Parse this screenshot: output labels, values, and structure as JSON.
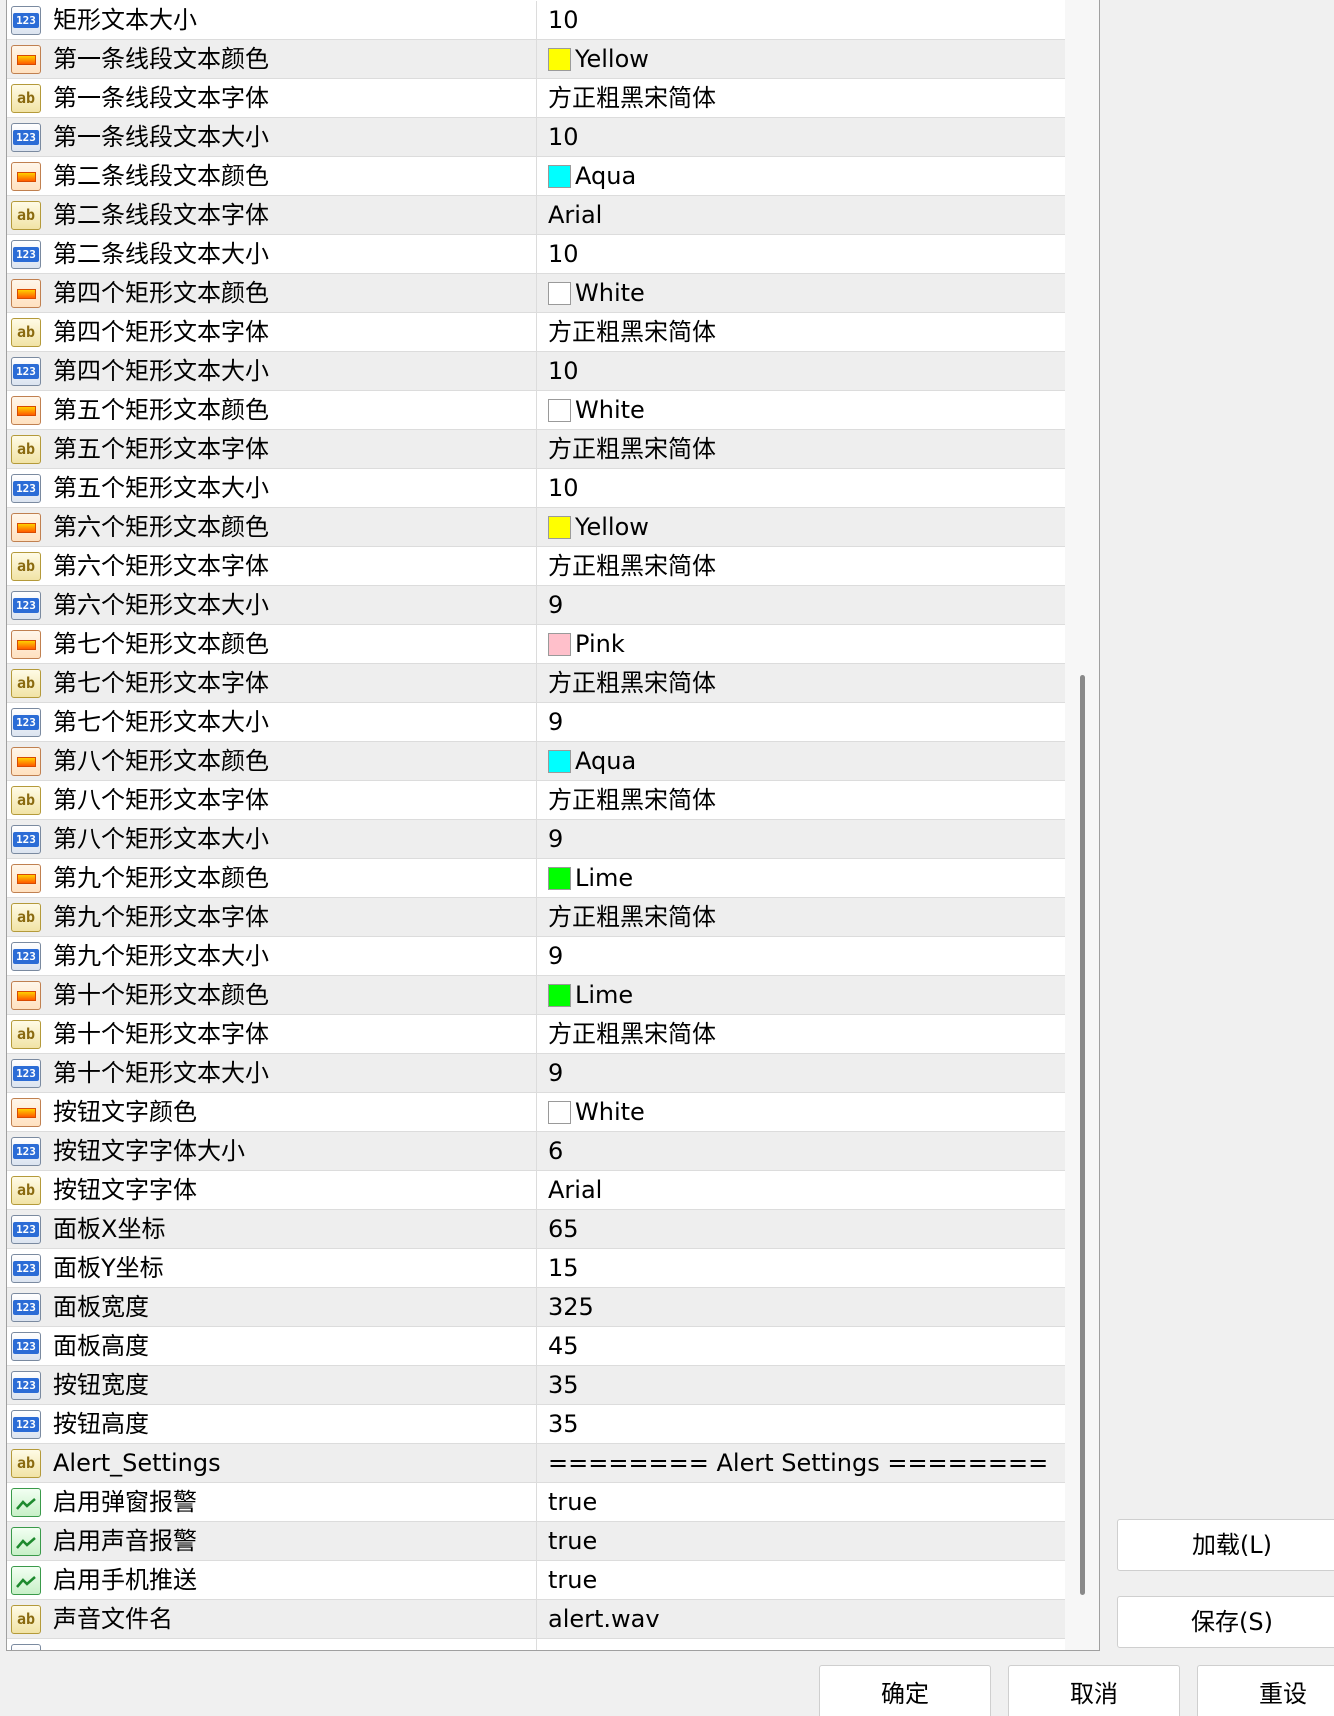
{
  "rows": [
    {
      "type": "num",
      "icon": "num-icon",
      "name": "矩形文本大小",
      "value": "10"
    },
    {
      "type": "color",
      "icon": "color-icon",
      "name": "第一条线段文本颜色",
      "value": "Yellow",
      "swatch": "#ffff00"
    },
    {
      "type": "str",
      "icon": "string-icon",
      "name": "第一条线段文本字体",
      "value": "方正粗黑宋简体"
    },
    {
      "type": "num",
      "icon": "num-icon",
      "name": "第一条线段文本大小",
      "value": "10"
    },
    {
      "type": "color",
      "icon": "color-icon",
      "name": "第二条线段文本颜色",
      "value": "Aqua",
      "swatch": "#00ffff"
    },
    {
      "type": "str",
      "icon": "string-icon",
      "name": "第二条线段文本字体",
      "value": "Arial"
    },
    {
      "type": "num",
      "icon": "num-icon",
      "name": "第二条线段文本大小",
      "value": "10"
    },
    {
      "type": "color",
      "icon": "color-icon",
      "name": "第四个矩形文本颜色",
      "value": "White",
      "swatch": "#ffffff"
    },
    {
      "type": "str",
      "icon": "string-icon",
      "name": "第四个矩形文本字体",
      "value": "方正粗黑宋简体"
    },
    {
      "type": "num",
      "icon": "num-icon",
      "name": "第四个矩形文本大小",
      "value": "10"
    },
    {
      "type": "color",
      "icon": "color-icon",
      "name": "第五个矩形文本颜色",
      "value": "White",
      "swatch": "#ffffff"
    },
    {
      "type": "str",
      "icon": "string-icon",
      "name": "第五个矩形文本字体",
      "value": "方正粗黑宋简体"
    },
    {
      "type": "num",
      "icon": "num-icon",
      "name": "第五个矩形文本大小",
      "value": "10"
    },
    {
      "type": "color",
      "icon": "color-icon",
      "name": "第六个矩形文本颜色",
      "value": "Yellow",
      "swatch": "#ffff00"
    },
    {
      "type": "str",
      "icon": "string-icon",
      "name": "第六个矩形文本字体",
      "value": "方正粗黑宋简体"
    },
    {
      "type": "num",
      "icon": "num-icon",
      "name": "第六个矩形文本大小",
      "value": "9"
    },
    {
      "type": "color",
      "icon": "color-icon",
      "name": "第七个矩形文本颜色",
      "value": "Pink",
      "swatch": "#ffc0cb"
    },
    {
      "type": "str",
      "icon": "string-icon",
      "name": "第七个矩形文本字体",
      "value": "方正粗黑宋简体"
    },
    {
      "type": "num",
      "icon": "num-icon",
      "name": "第七个矩形文本大小",
      "value": "9"
    },
    {
      "type": "color",
      "icon": "color-icon",
      "name": "第八个矩形文本颜色",
      "value": "Aqua",
      "swatch": "#00ffff"
    },
    {
      "type": "str",
      "icon": "string-icon",
      "name": "第八个矩形文本字体",
      "value": "方正粗黑宋简体"
    },
    {
      "type": "num",
      "icon": "num-icon",
      "name": "第八个矩形文本大小",
      "value": "9"
    },
    {
      "type": "color",
      "icon": "color-icon",
      "name": "第九个矩形文本颜色",
      "value": "Lime",
      "swatch": "#00ff00"
    },
    {
      "type": "str",
      "icon": "string-icon",
      "name": "第九个矩形文本字体",
      "value": "方正粗黑宋简体"
    },
    {
      "type": "num",
      "icon": "num-icon",
      "name": "第九个矩形文本大小",
      "value": "9"
    },
    {
      "type": "color",
      "icon": "color-icon",
      "name": "第十个矩形文本颜色",
      "value": "Lime",
      "swatch": "#00ff00"
    },
    {
      "type": "str",
      "icon": "string-icon",
      "name": "第十个矩形文本字体",
      "value": "方正粗黑宋简体"
    },
    {
      "type": "num",
      "icon": "num-icon",
      "name": "第十个矩形文本大小",
      "value": "9"
    },
    {
      "type": "color",
      "icon": "color-icon",
      "name": "按钮文字颜色",
      "value": "White",
      "swatch": "#ffffff"
    },
    {
      "type": "num",
      "icon": "num-icon",
      "name": "按钮文字字体大小",
      "value": "6"
    },
    {
      "type": "str",
      "icon": "string-icon",
      "name": "按钮文字字体",
      "value": "Arial"
    },
    {
      "type": "num",
      "icon": "num-icon",
      "name": "面板X坐标",
      "value": "65"
    },
    {
      "type": "num",
      "icon": "num-icon",
      "name": "面板Y坐标",
      "value": "15"
    },
    {
      "type": "num",
      "icon": "num-icon",
      "name": "面板宽度",
      "value": "325"
    },
    {
      "type": "num",
      "icon": "num-icon",
      "name": "面板高度",
      "value": "45"
    },
    {
      "type": "num",
      "icon": "num-icon",
      "name": "按钮宽度",
      "value": "35"
    },
    {
      "type": "num",
      "icon": "num-icon",
      "name": "按钮高度",
      "value": "35"
    },
    {
      "type": "str",
      "icon": "string-icon",
      "name": "Alert_Settings",
      "value": "======== Alert Settings ========"
    },
    {
      "type": "bool",
      "icon": "bool-icon",
      "name": "启用弹窗报警",
      "value": "true"
    },
    {
      "type": "bool",
      "icon": "bool-icon",
      "name": "启用声音报警",
      "value": "true"
    },
    {
      "type": "bool",
      "icon": "bool-icon",
      "name": "启用手机推送",
      "value": "true"
    },
    {
      "type": "str",
      "icon": "string-icon",
      "name": "声音文件名",
      "value": "alert.wav"
    },
    {
      "type": "num",
      "icon": "num-icon",
      "name": "",
      "value": ""
    }
  ],
  "icon_glyphs": {
    "num": "123",
    "str": "ab"
  },
  "buttons": {
    "load": "加载(L)",
    "save": "保存(S)",
    "ok": "确定",
    "cancel": "取消",
    "reset": "重设"
  }
}
